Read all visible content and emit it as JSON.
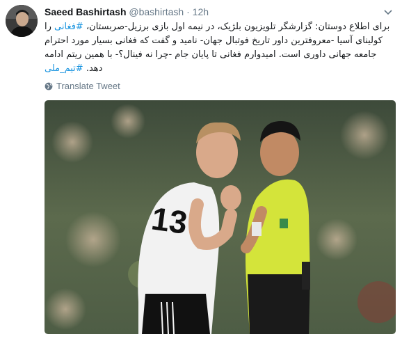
{
  "tweet": {
    "display_name": "Saeed Bashirtash",
    "handle": "@bashirtash",
    "separator": "·",
    "time": "12h",
    "text_line_1": "برای اطلاع دوستان: گزارشگر تلویزیون بلژیک، در نیمه اول بازی برزیل-صربستان، ",
    "hashtag_1": "#فغانی",
    "text_line_2": "را کولینای آسیا -معروفترین داور تاریخ فوتبال جهان- نامید و گفت که فغانی بسیار مورد احترام جامعه جهانی داوری است. امیدوارم فغانی تا پایان جام -چرا نه فینال؟- با همین ریتم ادامه دهد. ",
    "hashtag_2": "#تیم_ملی",
    "translate_label": "Translate Tweet"
  },
  "photo": {
    "description_jersey_number": "13"
  },
  "colors": {
    "link": "#1b95e0",
    "muted": "#657786",
    "text": "#14171a"
  }
}
